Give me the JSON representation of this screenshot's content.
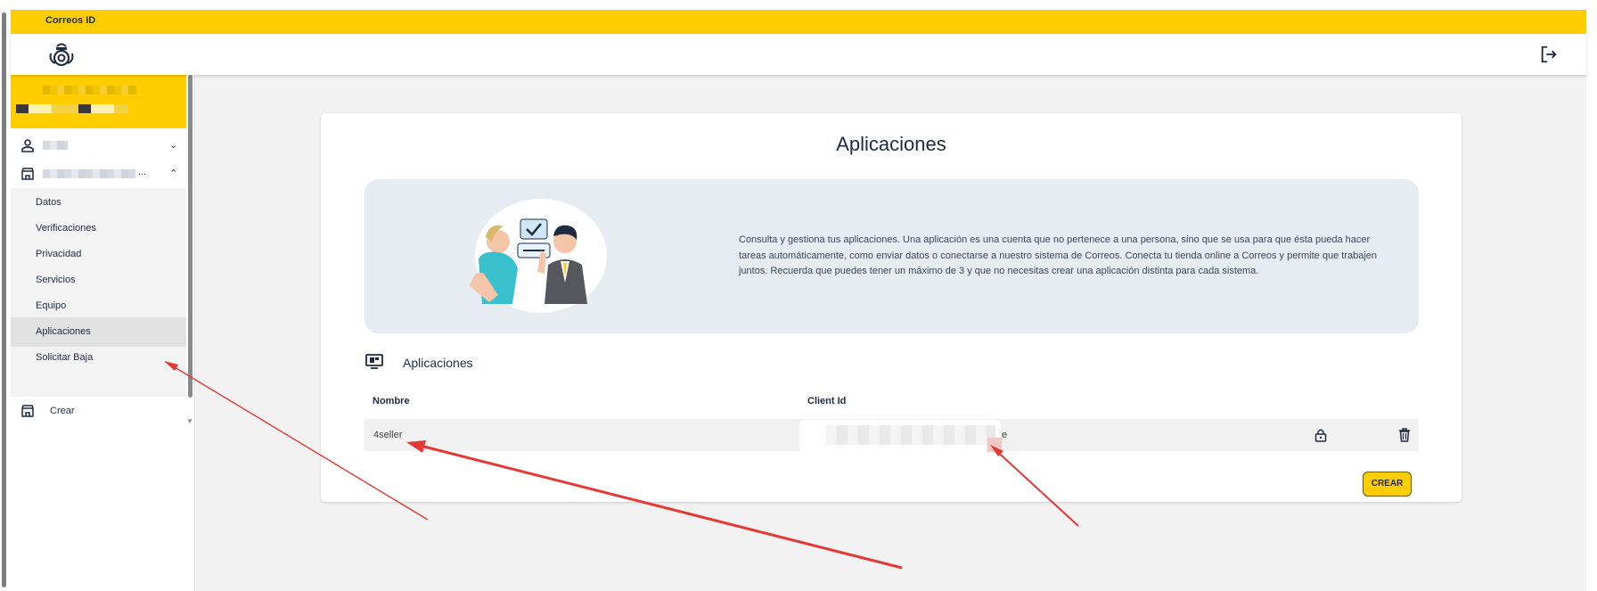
{
  "topbar": {
    "title": "Correos ID"
  },
  "sidebar": {
    "submenu": [
      {
        "label": "Datos"
      },
      {
        "label": "Verificaciones"
      },
      {
        "label": "Privacidad"
      },
      {
        "label": "Servicios"
      },
      {
        "label": "Equipo"
      },
      {
        "label": "Aplicaciones",
        "active": true
      },
      {
        "label": "Solicitar Baja"
      }
    ],
    "create_label": "Crear",
    "group_truncation": "..."
  },
  "main": {
    "title": "Aplicaciones",
    "info_text": "Consulta y gestiona tus aplicaciones. Una aplicación es una cuenta que no pertenece a una persona, sino que se usa para que ésta pueda hacer tareas automáticamente, como enviar datos o conectarse a nuestro sistema de Correos. Conecta tu tienda online a Correos y permite que trabajen juntos. Recuerda que puedes tener un máximo de 3 y que no necesitas crear una aplicación distinta para cada sistema.",
    "section_title": "Aplicaciones",
    "table": {
      "headers": {
        "name": "Nombre",
        "client_id": "Client Id"
      },
      "rows": [
        {
          "name": "4seller",
          "client_id_tail": "e"
        }
      ]
    },
    "create_button": "CREAR"
  },
  "colors": {
    "brand_yellow": "#ffcd00",
    "navy": "#1f2a44",
    "annotation_red": "#e53935"
  },
  "icons": [
    "correos-logo-icon",
    "logout-icon",
    "user-icon",
    "store-icon",
    "apps-monitor-icon",
    "lock-icon",
    "trash-icon"
  ]
}
